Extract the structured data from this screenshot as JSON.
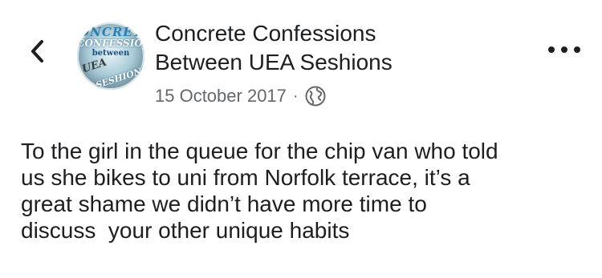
{
  "post": {
    "page_name_line1": "Concrete Confessions",
    "page_name_line2": "Between UEA Seshions",
    "date": "15 October 2017",
    "separator": "·",
    "privacy_icon": "globe-icon",
    "body": "To the girl in the queue for the chip van who told\nus she bikes to uni from Norfolk terrace, it’s a\ngreat shame we didn’t have more time to\ndiscuss  your other unique habits"
  },
  "avatar": {
    "line1": "ONCRET",
    "line2": "CONFESSIONS",
    "line3": "between",
    "line4": "UEA",
    "line5": "SESHIONS"
  },
  "icons": {
    "back": "chevron-left-icon",
    "more": "more-horizontal-icon"
  },
  "colors": {
    "text_primary": "#1c1e21",
    "text_secondary": "#65676b",
    "background": "#ffffff"
  }
}
